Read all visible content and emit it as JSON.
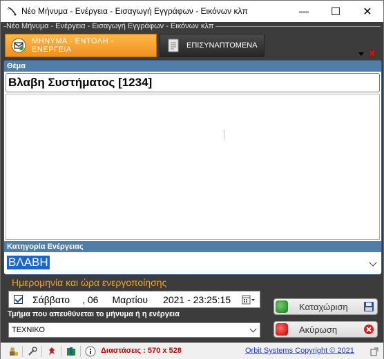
{
  "window": {
    "title": "Νέο Μήνυμα - Ενέργεια - Εισαγωγή Εγγράφων - Εικόνων κλπ",
    "frame_caption": "Νέο Μήνυμα - Ενέργεια - Εισαγωγή Εγγράφων - Εικόνων κλπ",
    "minimize_glyph": "—",
    "maximize_glyph": "☐",
    "close_glyph": "✕"
  },
  "tabs": [
    {
      "label": "ΜΗΝΥΜΑ - ΕΝΤΟΛΗ - ΕΝΕΡΓΕΙΑ",
      "icon": "message-icon",
      "active": true
    },
    {
      "label": "ΕΠΙΣΥΝΑΠΤΟΜΕΝΑ",
      "icon": "attachment-icon",
      "active": false
    }
  ],
  "subject": {
    "label": "Θέμα",
    "value": "Βλαβη Συστήματος [1234]"
  },
  "body": {
    "value": ""
  },
  "category": {
    "label": "Κατηγορία Ενέργειας",
    "value": "ΒΛΑΒΗ"
  },
  "activation": {
    "label": "Ημερομηνία και ώρα ενεργοποίησης",
    "checked": true,
    "day_name": "Σάββατο",
    "day": ", 06",
    "month": "Μαρτίου",
    "year_time": "2021 - 23:25:15"
  },
  "department": {
    "label": "Τμήμα που απευθύνεται το μήνυμα ή η ενέργεια",
    "value": "ΤΕΧΝΙΚΟ"
  },
  "buttons": {
    "save_label": "Καταχώριση",
    "cancel_label": "Ακύρωση"
  },
  "statusbar": {
    "dimensions": "Διαστάσεις : 570 x 528",
    "copyright": "Orbit Systems Copyright ©  2021"
  },
  "colors": {
    "accent_orange": "#f09020",
    "section_header": "#507ea8",
    "date_title": "#f4a31a",
    "dims_red": "#c00000",
    "link_blue": "#1f3fbf"
  }
}
